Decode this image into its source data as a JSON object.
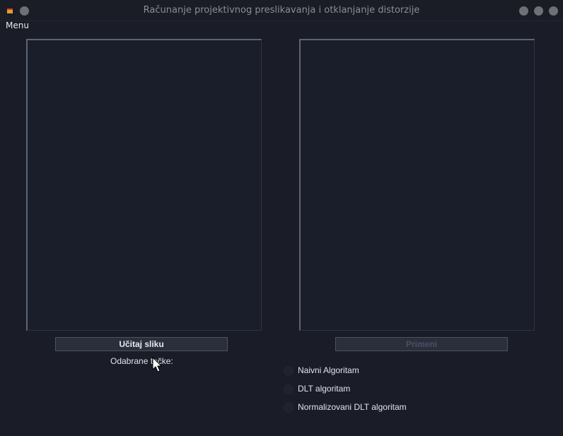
{
  "window": {
    "title": "Računanje projektivnog preslikavanja i otklanjanje distorzije"
  },
  "menubar": {
    "menu_label": "Menu"
  },
  "left": {
    "load_button": "Učitaj sliku",
    "selected_points_label": "Odabrane tačke:"
  },
  "right": {
    "apply_button": "Primeni",
    "apply_enabled": false
  },
  "algorithms": [
    {
      "label": "Naivni Algoritam",
      "selected": false
    },
    {
      "label": "DLT algoritam",
      "selected": false
    },
    {
      "label": "Normalizovani DLT algoritam",
      "selected": false
    }
  ],
  "icons": {
    "app": "app-icon",
    "close": "close-icon",
    "minimize": "minimize-icon",
    "maximize": "maximize-icon",
    "pointer": "mouse-pointer-icon"
  },
  "colors": {
    "background": "#1a1d27",
    "panel": "#1a1e2a",
    "button": "#2b2f3b",
    "disabled_text": "#4a5066"
  }
}
